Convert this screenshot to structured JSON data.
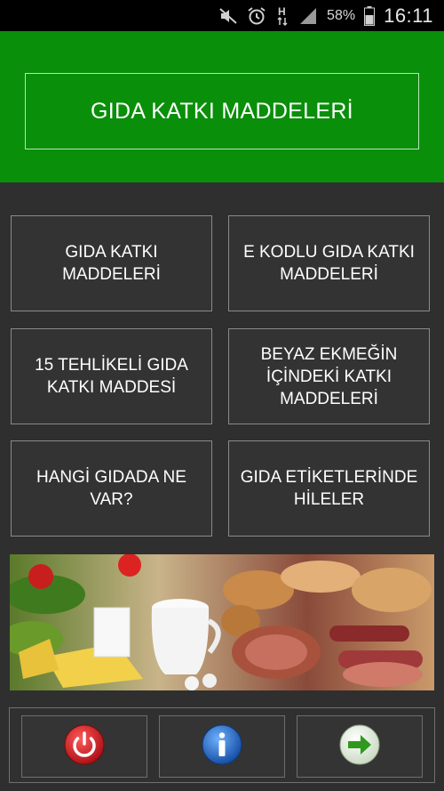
{
  "status_bar": {
    "battery_percent": "58%",
    "time": "16:11",
    "icons": [
      "mute-icon",
      "alarm-icon",
      "h-data-icon",
      "signal-icon",
      "battery-icon"
    ]
  },
  "header": {
    "title": "GIDA KATKI MADDELERİ",
    "background_color": "#0a8f0a"
  },
  "menu": {
    "items": [
      {
        "label": "GIDA KATKI\nMADDELERİ"
      },
      {
        "label": "E KODLU GIDA KATKI\nMADDELERİ"
      },
      {
        "label": "15 TEHLİKELİ GIDA\nKATKI MADDESİ"
      },
      {
        "label": "BEYAZ EKMEĞİN\nİÇİNDEKİ KATKI\nMADDELERİ"
      },
      {
        "label": "HANGİ GIDADA NE\nVAR?"
      },
      {
        "label": "GIDA ETİKETLERİNDE\nHİLELER"
      }
    ]
  },
  "bottom_bar": {
    "buttons": [
      {
        "icon": "power-icon",
        "color": "#c8141a"
      },
      {
        "icon": "info-icon",
        "color": "#1b62c4"
      },
      {
        "icon": "arrow-right-icon",
        "color": "#2e9a1c"
      }
    ]
  }
}
